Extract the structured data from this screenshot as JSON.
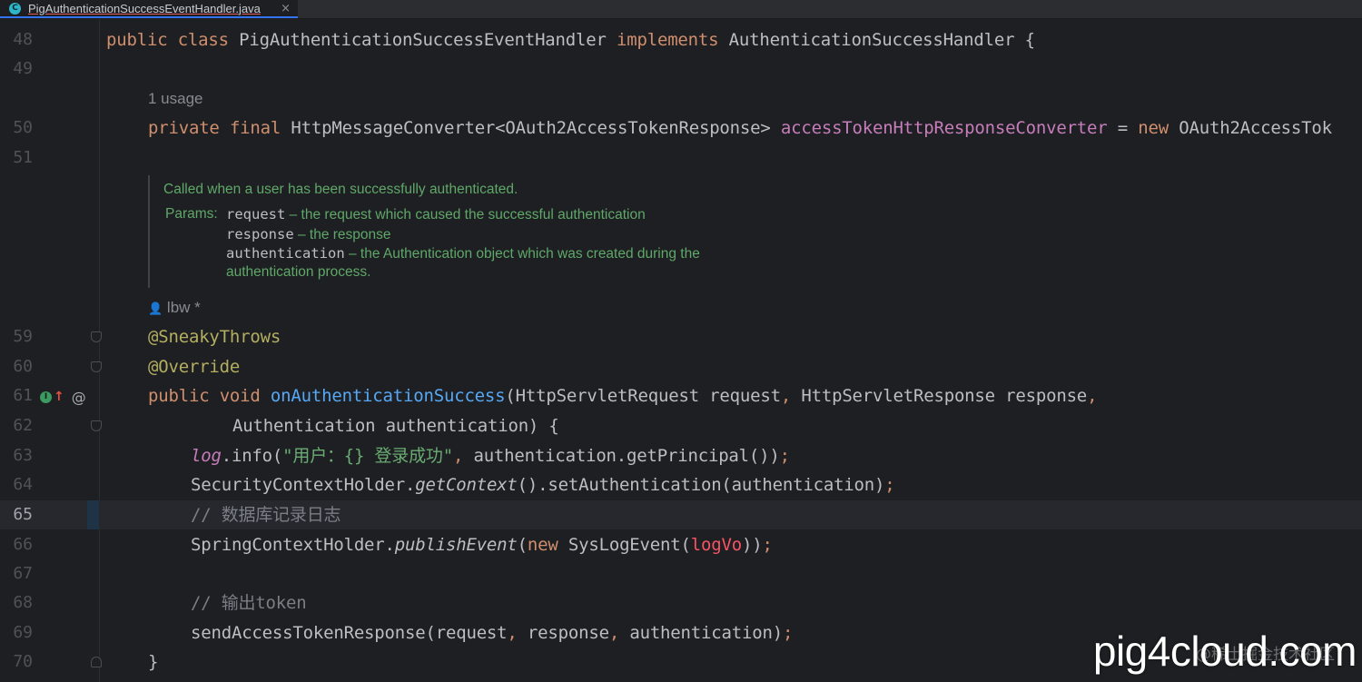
{
  "tab": {
    "icon_letter": "C",
    "file_name": "PigAuthenticationSuccessEventHandler.java",
    "close": "×"
  },
  "lines": {
    "l48": {
      "num": "48"
    },
    "l49": {
      "num": "49"
    },
    "l50": {
      "num": "50"
    },
    "l51": {
      "num": "51"
    },
    "l59": {
      "num": "59"
    },
    "l60": {
      "num": "60"
    },
    "l61": {
      "num": "61"
    },
    "l62": {
      "num": "62"
    },
    "l63": {
      "num": "63"
    },
    "l64": {
      "num": "64"
    },
    "l65": {
      "num": "65"
    },
    "l66": {
      "num": "66"
    },
    "l67": {
      "num": "67"
    },
    "l68": {
      "num": "68"
    },
    "l69": {
      "num": "69"
    },
    "l70": {
      "num": "70"
    }
  },
  "code": {
    "public": "public",
    "class": "class",
    "class_name": "PigAuthenticationSuccessEventHandler",
    "implements": "implements",
    "interface_name": "AuthenticationSuccessHandler",
    "brace_open": "{",
    "usage_hint": "1 usage",
    "private": "private",
    "final": "final",
    "field_type": "HttpMessageConverter<OAuth2AccessTokenResponse>",
    "field_name": "accessTokenHttpResponseConverter",
    "equals": "=",
    "new": "new",
    "field_init": "OAuth2AccessTok",
    "author_hint": "lbw *",
    "ann_sneaky": "@SneakyThrows",
    "ann_override": "@Override",
    "void": "void",
    "method_name": "onAuthenticationSuccess",
    "params_1a": "(HttpServletRequest request",
    "comma": ",",
    "params_1b": "HttpServletResponse response",
    "params_2": "Authentication authentication) {",
    "log": "log",
    "info_call": ".info(",
    "log_string": "\"用户：{} 登录成功\"",
    "log_rest": "authentication.getPrincipal())",
    "semi": ";",
    "sch_class": "SecurityContextHolder.",
    "get_context": "getContext",
    "sch_rest": "().setAuthentication(authentication)",
    "comment_db": "// 数据库记录日志",
    "spch_class": "SpringContextHolder.",
    "publish_event": "publishEvent",
    "paren_open": "(",
    "syslog_event": "SysLogEvent(",
    "logvo": "logVo",
    "parens_close": "))",
    "comment_token": "// 输出token",
    "send_call": "sendAccessTokenResponse(request",
    "send_arg2": "response",
    "send_arg3": "authentication)",
    "brace_close": "}"
  },
  "doc": {
    "summary": "Called when a user has been successfully authenticated.",
    "params_label": "Params:",
    "p1_name": "request",
    "p1_desc": " – the request which caused the successful authentication",
    "p2_name": "response",
    "p2_desc": " – the response",
    "p3_name": "authentication",
    "p3_desc": " – the Authentication object which was created during the",
    "p3_desc2": "authentication process."
  },
  "gutter": {
    "impl_icon": "I",
    "at_icon": "@"
  },
  "watermark": {
    "text": "pig4cloud.com",
    "sub": "@稀土掘金技术社区"
  },
  "colors": {
    "background": "#1e1f22",
    "keyword": "#cf8e6d",
    "annotation": "#b3ae60",
    "method": "#56a8f5",
    "field": "#c77dbb",
    "string": "#6aab73",
    "comment": "#7a7e85",
    "doc": "#5fa869"
  }
}
